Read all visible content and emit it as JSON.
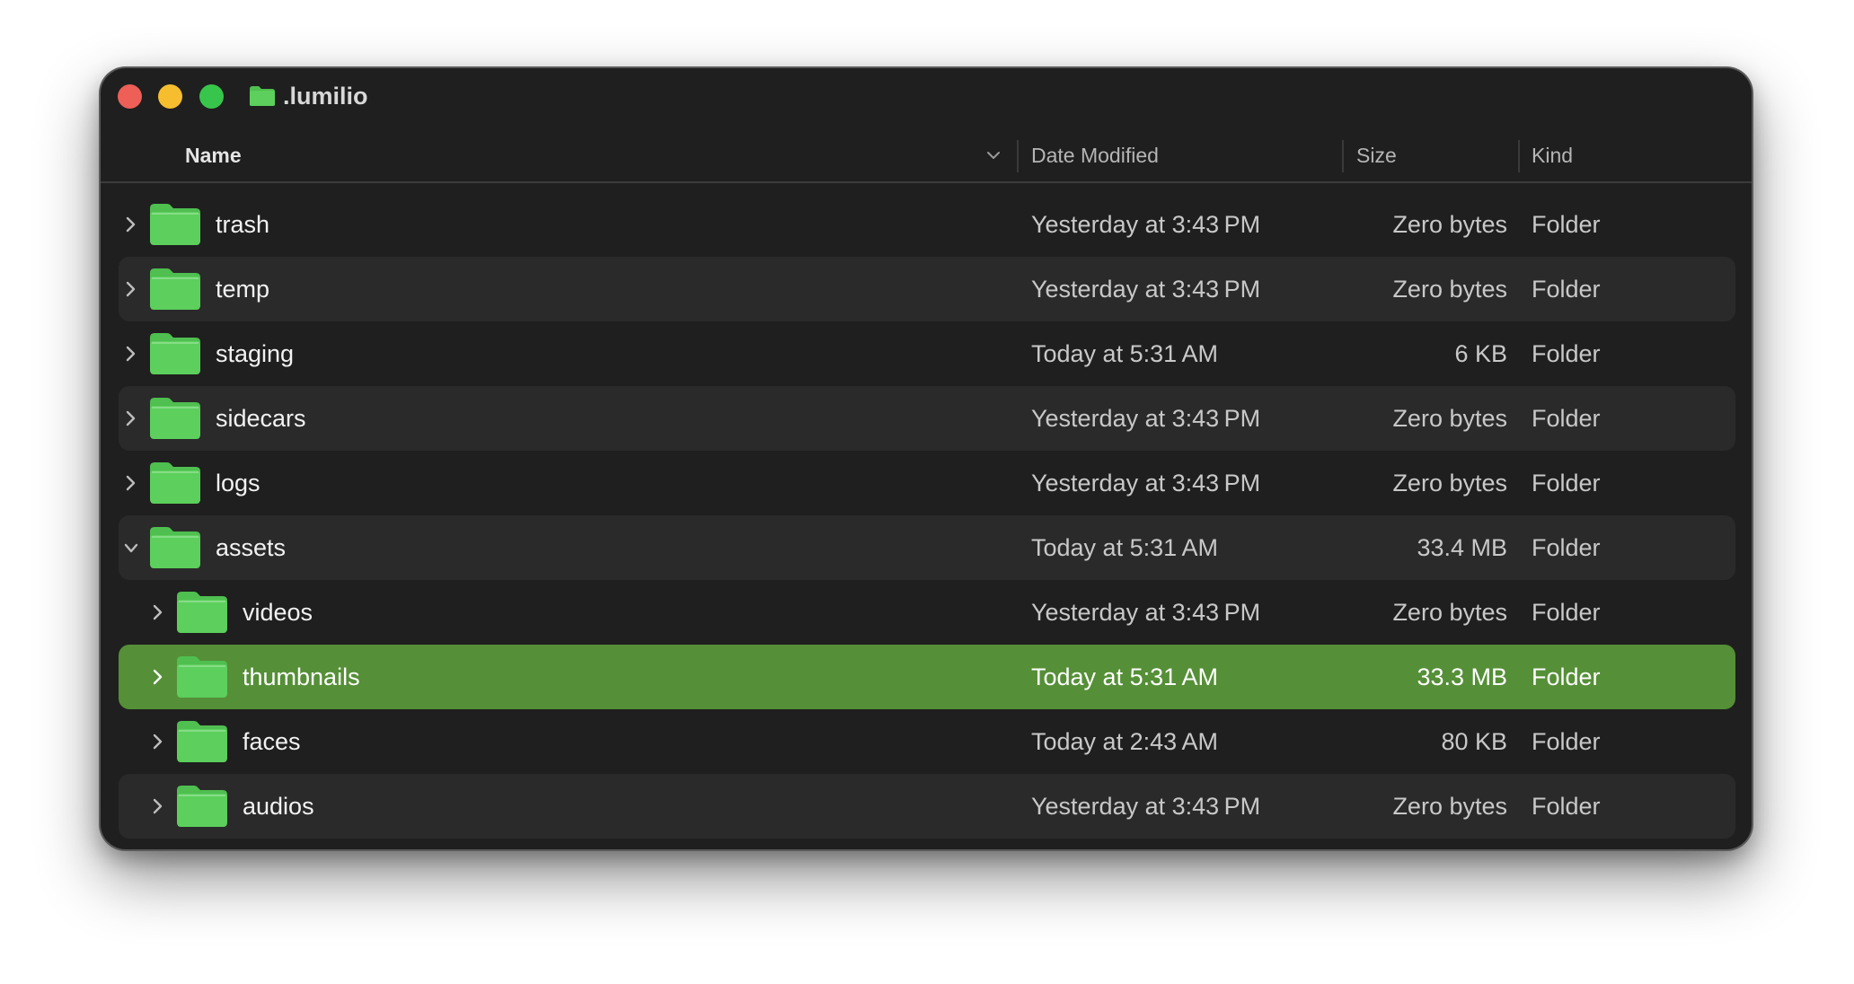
{
  "window": {
    "title": ".lumilio",
    "title_icon": "folder-icon"
  },
  "columns": {
    "name": "Name",
    "date": "Date Modified",
    "size": "Size",
    "kind": "Kind"
  },
  "rows": [
    {
      "name": "trash",
      "date": "Yesterday at 3:43 PM",
      "size": "Zero bytes",
      "kind": "Folder",
      "depth": 0,
      "expanded": false,
      "selected": false
    },
    {
      "name": "temp",
      "date": "Yesterday at 3:43 PM",
      "size": "Zero bytes",
      "kind": "Folder",
      "depth": 0,
      "expanded": false,
      "selected": false
    },
    {
      "name": "staging",
      "date": "Today at 5:31 AM",
      "size": "6 KB",
      "kind": "Folder",
      "depth": 0,
      "expanded": false,
      "selected": false
    },
    {
      "name": "sidecars",
      "date": "Yesterday at 3:43 PM",
      "size": "Zero bytes",
      "kind": "Folder",
      "depth": 0,
      "expanded": false,
      "selected": false
    },
    {
      "name": "logs",
      "date": "Yesterday at 3:43 PM",
      "size": "Zero bytes",
      "kind": "Folder",
      "depth": 0,
      "expanded": false,
      "selected": false
    },
    {
      "name": "assets",
      "date": "Today at 5:31 AM",
      "size": "33.4 MB",
      "kind": "Folder",
      "depth": 0,
      "expanded": true,
      "selected": false
    },
    {
      "name": "videos",
      "date": "Yesterday at 3:43 PM",
      "size": "Zero bytes",
      "kind": "Folder",
      "depth": 1,
      "expanded": false,
      "selected": false
    },
    {
      "name": "thumbnails",
      "date": "Today at 5:31 AM",
      "size": "33.3 MB",
      "kind": "Folder",
      "depth": 1,
      "expanded": false,
      "selected": true
    },
    {
      "name": "faces",
      "date": "Today at 2:43 AM",
      "size": "80 KB",
      "kind": "Folder",
      "depth": 1,
      "expanded": false,
      "selected": false
    },
    {
      "name": "audios",
      "date": "Yesterday at 3:43 PM",
      "size": "Zero bytes",
      "kind": "Folder",
      "depth": 1,
      "expanded": false,
      "selected": false
    }
  ],
  "colors": {
    "folder": "#5ccf5c",
    "folder_tab": "#4fbf50",
    "selection": "#558f37",
    "window_bg": "#1f1f1f"
  }
}
